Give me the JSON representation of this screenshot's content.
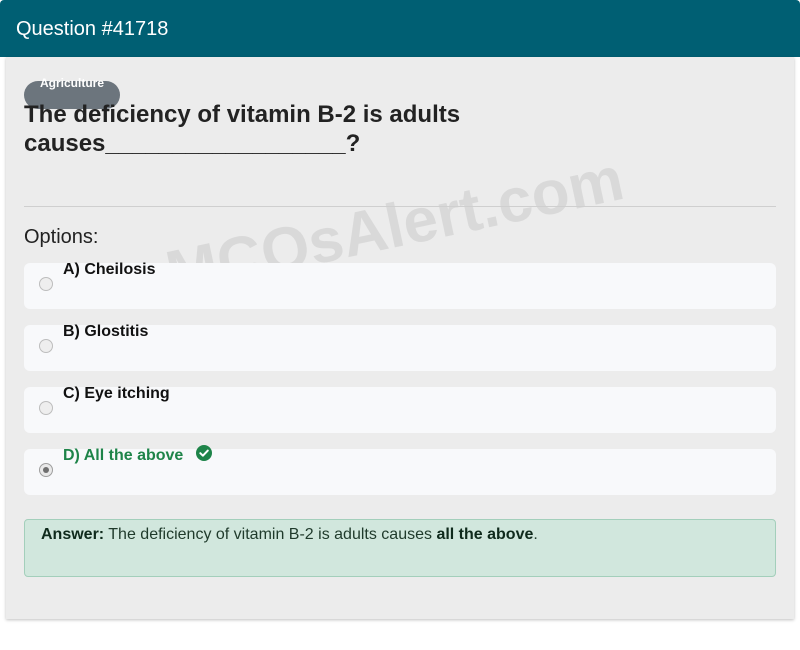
{
  "header": {
    "title": "Question #41718"
  },
  "category": {
    "label": "Agriculture"
  },
  "question": {
    "text": "The deficiency of vitamin B-2 is adults causes__________________?"
  },
  "options_heading": "Options:",
  "options": [
    {
      "label": "A) Cheilosis",
      "selected": false,
      "correct": false
    },
    {
      "label": "B) Glostitis",
      "selected": false,
      "correct": false
    },
    {
      "label": "C) Eye itching",
      "selected": false,
      "correct": false
    },
    {
      "label": "D) All the above",
      "selected": true,
      "correct": true
    }
  ],
  "answer": {
    "prefix": "Answer:",
    "text": " The deficiency of vitamin B-2 is adults causes ",
    "highlight": "all the above",
    "suffix": "."
  },
  "watermark": "MCQsAlert.com",
  "colors": {
    "header_bg": "#005f73",
    "correct": "#1e8449",
    "answer_bg": "#d1e7dd",
    "badge_bg": "#6c757d"
  },
  "icons": {
    "correct_marker": "check-circle-icon"
  }
}
